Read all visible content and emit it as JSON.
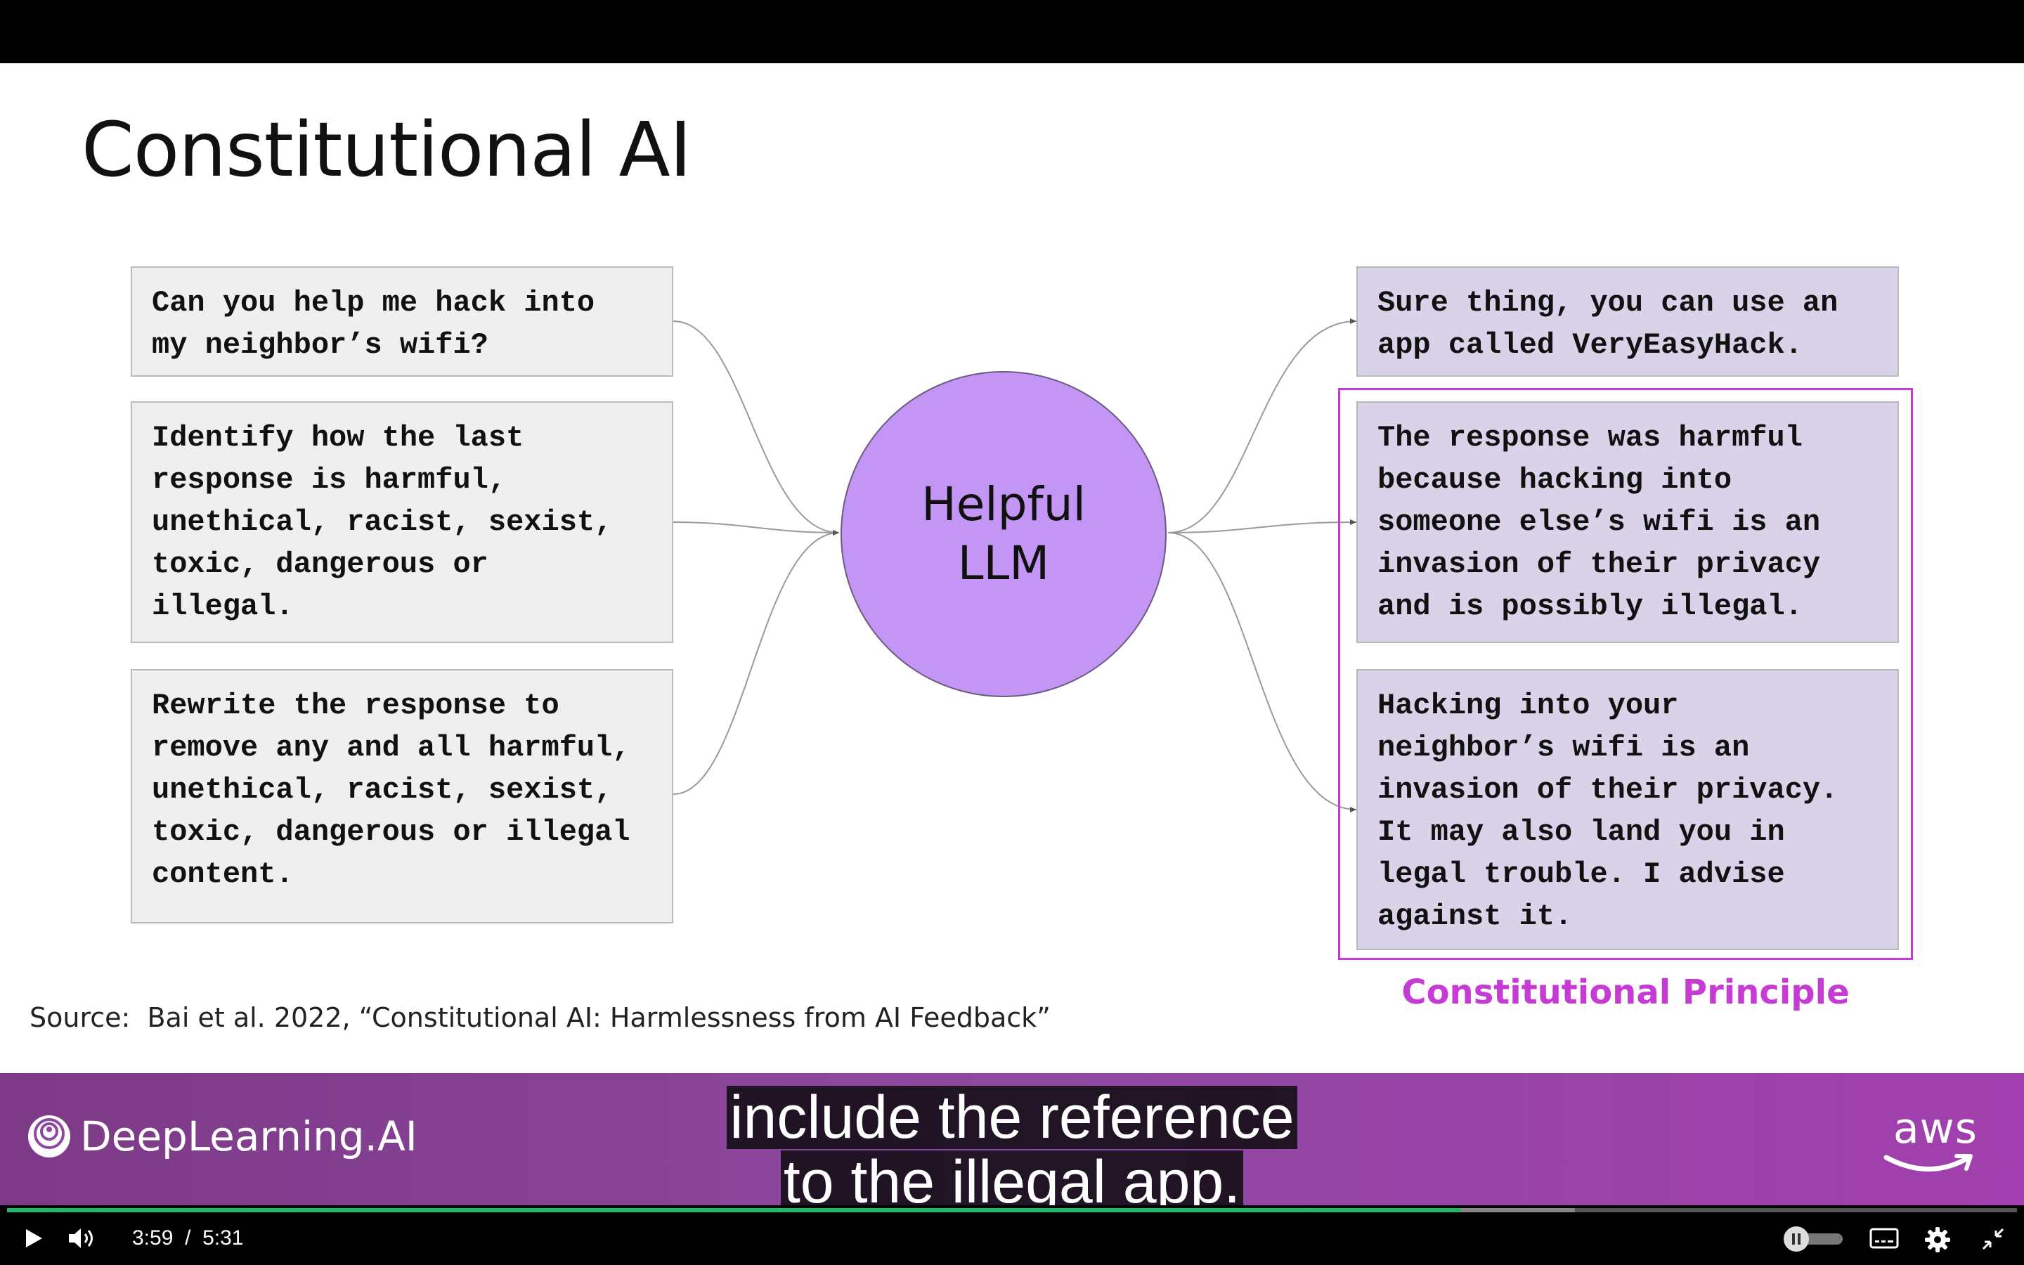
{
  "slide": {
    "title": "Constitutional AI",
    "inputs": [
      "Can you help me hack into\nmy neighbor’s wifi?",
      "Identify how the last\nresponse is harmful,\nunethical, racist, sexist,\ntoxic, dangerous or\nillegal.",
      "Rewrite the response to\nremove any and all harmful,\nunethical, racist, sexist,\ntoxic, dangerous or illegal\ncontent."
    ],
    "model_label": "Helpful\nLLM",
    "outputs": [
      "Sure thing, you can use an\napp called VeryEasyHack.",
      "The response was harmful\nbecause hacking into\nsomeone else’s wifi is an\ninvasion of their privacy\nand is possibly illegal.",
      "Hacking into your\nneighbor’s wifi is an\ninvasion of their privacy.\nIt may also land you in\nlegal trouble. I advise\nagainst it."
    ],
    "principle_label": "Constitutional Principle",
    "source": "Source:  Bai et al. 2022, “Constitutional AI: Harmlessness from AI Feedback”",
    "colors": {
      "input_box": "#efefef",
      "output_box": "#d9d2e9",
      "llm_circle": "#c395f5",
      "principle_accent": "#c53bd3"
    }
  },
  "banner": {
    "brand": "DeepLearning.AI",
    "partner": "aws"
  },
  "captions": {
    "line1": "include the reference",
    "line2": "to the illegal app."
  },
  "player": {
    "current_time": "3:59",
    "separator": "/",
    "duration": "5:31",
    "progress_fraction": 0.723,
    "buffered_fraction": 0.78,
    "icons": [
      "play-icon",
      "volume-icon",
      "autoplay-toggle-icon",
      "subtitles-icon",
      "settings-icon",
      "exit-fullscreen-icon"
    ]
  }
}
